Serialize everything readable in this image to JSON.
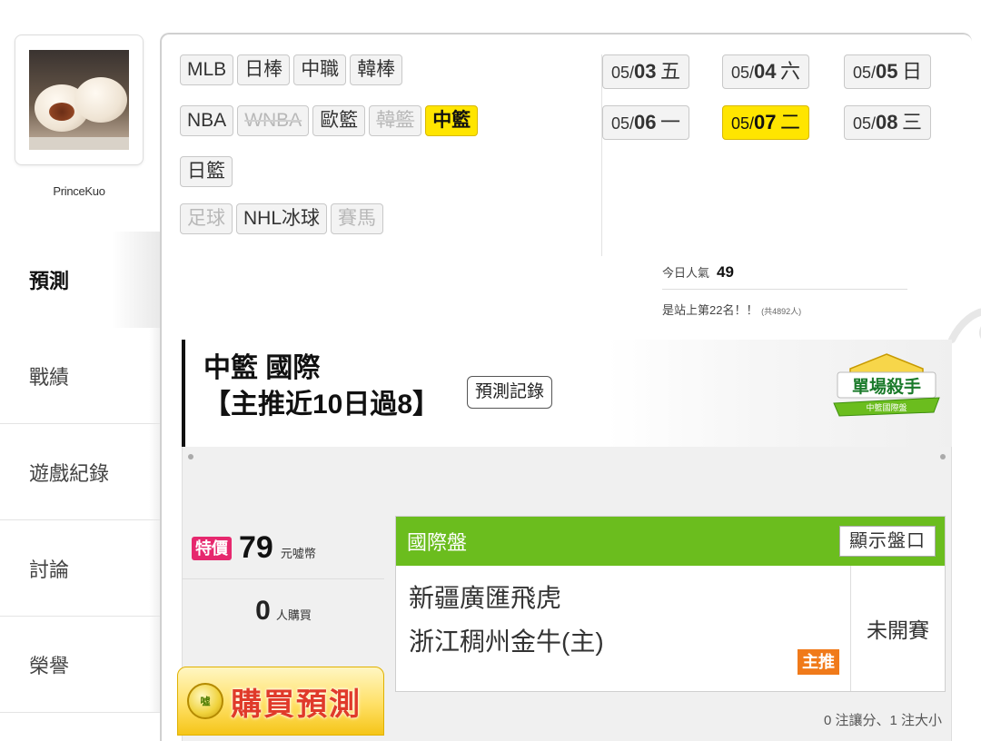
{
  "sidebar": {
    "username": "PrinceKuo",
    "items": [
      {
        "label": "預測",
        "active": true
      },
      {
        "label": "戰績",
        "active": false
      },
      {
        "label": "遊戲紀錄",
        "active": false
      },
      {
        "label": "討論",
        "active": false
      },
      {
        "label": "榮譽",
        "active": false
      }
    ]
  },
  "sports": {
    "row1": [
      {
        "label": "MLB",
        "state": "normal"
      },
      {
        "label": "日棒",
        "state": "normal"
      },
      {
        "label": "中職",
        "state": "normal"
      },
      {
        "label": "韓棒",
        "state": "normal"
      }
    ],
    "row2": [
      {
        "label": "NBA",
        "state": "normal"
      },
      {
        "label": "WNBA",
        "state": "disabled"
      },
      {
        "label": "歐籃",
        "state": "normal"
      },
      {
        "label": "韓籃",
        "state": "disabled"
      },
      {
        "label": "中籃",
        "state": "active"
      }
    ],
    "row3": [
      {
        "label": "日籃",
        "state": "normal"
      }
    ],
    "row4": [
      {
        "label": "足球",
        "state": "muted"
      },
      {
        "label": "NHL冰球",
        "state": "normal"
      },
      {
        "label": "賽馬",
        "state": "muted"
      }
    ]
  },
  "dates": {
    "row1": [
      {
        "md": "05/",
        "d": "03",
        "w": "五",
        "active": false
      },
      {
        "md": "05/",
        "d": "04",
        "w": "六",
        "active": false
      },
      {
        "md": "05/",
        "d": "05",
        "w": "日",
        "active": false
      }
    ],
    "row2": [
      {
        "md": "05/",
        "d": "06",
        "w": "一",
        "active": false
      },
      {
        "md": "05/",
        "d": "07",
        "w": "二",
        "active": true
      },
      {
        "md": "05/",
        "d": "08",
        "w": "三",
        "active": false
      }
    ]
  },
  "popularity": {
    "label": "今日人氣",
    "value": "49",
    "rank_text": "是站上第22名！！",
    "total_text": "(共4892人)"
  },
  "prediction": {
    "title_line1": "中籃 國際",
    "title_line2": "【主推近10日過8】",
    "record_button": "預測記錄",
    "badge_line1": "單場殺手",
    "badge_line2": "中籃國際盤"
  },
  "purchase": {
    "special_label": "特價",
    "price": "79",
    "price_unit": "元噓幣",
    "buyers": "0",
    "buyers_unit": "人購買",
    "coin_label": "噓",
    "buy_button": "購買預測"
  },
  "game": {
    "market": "國際盤",
    "show_odds_button": "顯示盤口",
    "away_team": "新疆廣匯飛虎",
    "home_team": "浙江稠州金牛(主)",
    "main_pick_tag": "主推",
    "status": "未開賽",
    "summary": "0 注讓分、1 注大小"
  },
  "colors": {
    "active_yellow": "#ffe500",
    "market_green": "#6bbd1e",
    "special_pink": "#e6286e",
    "pick_orange": "#f07a1a",
    "buy_red": "#e03a2a"
  }
}
